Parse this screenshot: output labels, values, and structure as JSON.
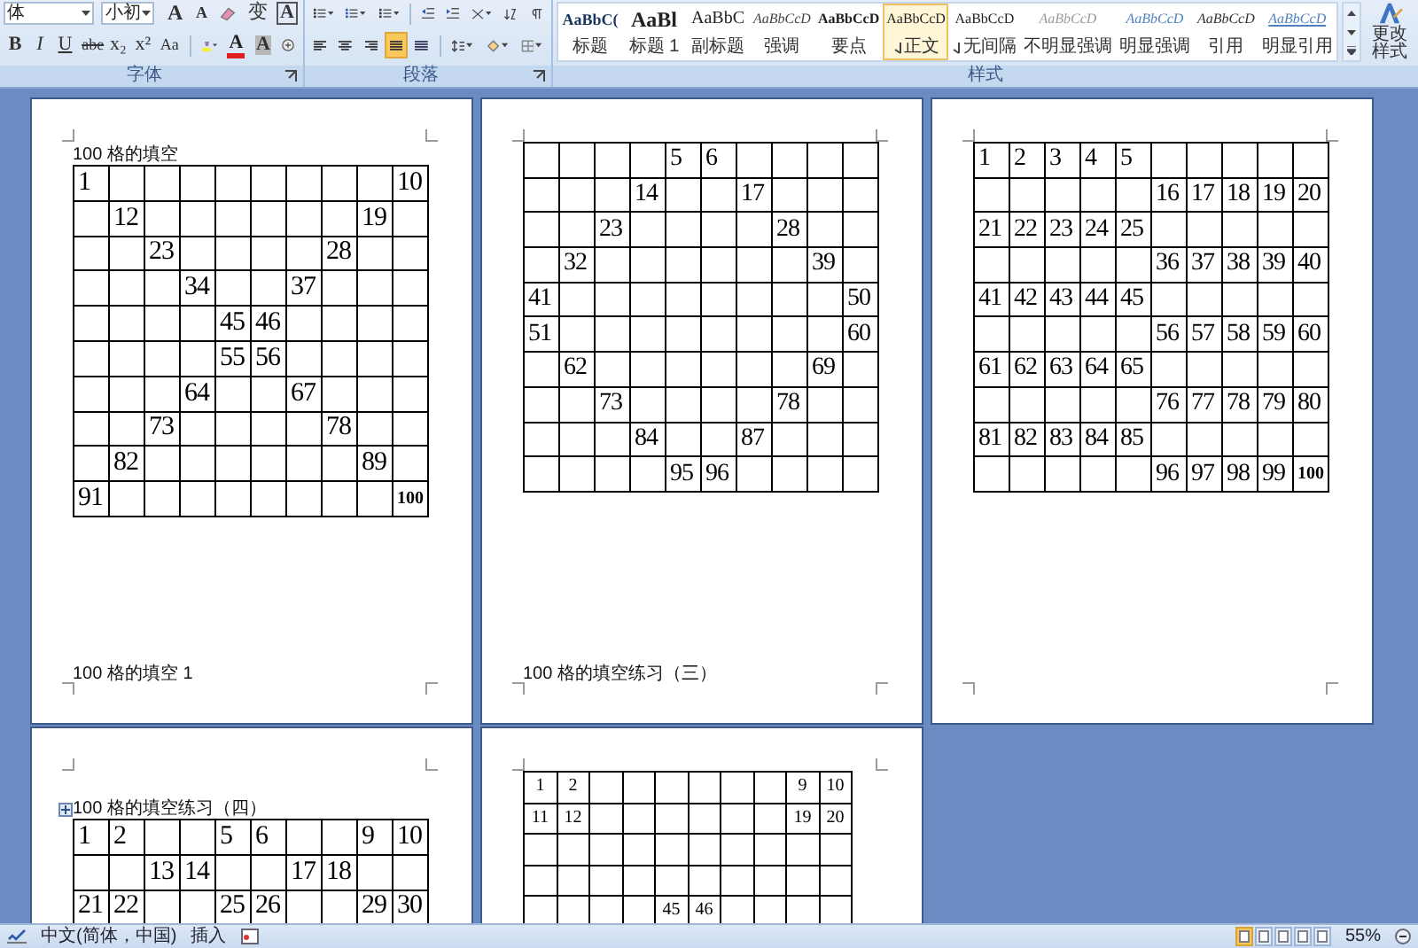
{
  "ribbon": {
    "font_group": {
      "label": "字体",
      "font_name": "体",
      "font_size": "小初",
      "top_buttons": [
        {
          "kind": "grow",
          "label": "A"
        },
        {
          "kind": "shrink",
          "label": "A"
        },
        {
          "kind": "clear"
        },
        {
          "kind": "phonetic",
          "label": "变"
        },
        {
          "kind": "boxed",
          "label": "A"
        }
      ],
      "bottom_buttons": [
        {
          "kind": "bold",
          "label": "B"
        },
        {
          "kind": "italic",
          "label": "I"
        },
        {
          "kind": "underline",
          "label": "U"
        },
        {
          "kind": "strike",
          "label": "abe"
        },
        {
          "kind": "sub",
          "label": "x₂"
        },
        {
          "kind": "sup",
          "label": "x²"
        },
        {
          "kind": "case",
          "label": "Aa"
        },
        {
          "kind": "highlight"
        },
        {
          "kind": "color",
          "label": "A"
        },
        {
          "kind": "shade",
          "label": "A"
        },
        {
          "kind": "enclose"
        }
      ]
    },
    "paragraph_group": {
      "label": "段落",
      "alignments": [
        {
          "kind": "left",
          "selected": false
        },
        {
          "kind": "center",
          "selected": false
        },
        {
          "kind": "right",
          "selected": false
        },
        {
          "kind": "justify",
          "selected": true
        },
        {
          "kind": "distributed",
          "selected": false
        }
      ]
    },
    "styles_group": {
      "label": "样式",
      "styles": [
        {
          "kind": "title",
          "sample": "AaBbC(",
          "name": "标题",
          "selected": false,
          "paragraph_mark": false
        },
        {
          "kind": "heading",
          "sample": "AaBl",
          "name": "标题 1",
          "selected": false,
          "paragraph_mark": false
        },
        {
          "kind": "subtitle",
          "sample": "AaBbC",
          "name": "副标题",
          "selected": false,
          "paragraph_mark": false
        },
        {
          "kind": "emphasis",
          "sample": "AaBbCcD",
          "name": "强调",
          "selected": false,
          "paragraph_mark": false
        },
        {
          "kind": "strong",
          "sample": "AaBbCcD",
          "name": "要点",
          "selected": false,
          "paragraph_mark": false
        },
        {
          "kind": "normal",
          "sample": "AaBbCcD",
          "name": "正文",
          "selected": true,
          "paragraph_mark": true
        },
        {
          "kind": "normal",
          "sample": "AaBbCcD",
          "name": "无间隔",
          "selected": false,
          "paragraph_mark": true
        },
        {
          "kind": "subtle",
          "sample": "AaBbCcD",
          "name": "不明显强调",
          "selected": false,
          "paragraph_mark": false
        },
        {
          "kind": "intense",
          "sample": "AaBbCcD",
          "name": "明显强调",
          "selected": false,
          "paragraph_mark": false
        },
        {
          "kind": "quote",
          "sample": "AaBbCcD",
          "name": "引用",
          "selected": false,
          "paragraph_mark": false
        },
        {
          "kind": "intense_quote",
          "sample": "AaBbCcD",
          "name": "明显引用",
          "selected": false,
          "paragraph_mark": false
        }
      ],
      "change_styles": "更改样式"
    }
  },
  "pages": [
    {
      "kind": "large",
      "header": "100 格的填空",
      "anchor": false,
      "footer": "100 格的填空 1",
      "rows": [
        [
          "1",
          null,
          null,
          null,
          null,
          null,
          null,
          null,
          null,
          "10"
        ],
        [
          null,
          "12",
          null,
          null,
          null,
          null,
          null,
          null,
          "19",
          null
        ],
        [
          null,
          null,
          "23",
          null,
          null,
          null,
          null,
          "28",
          null,
          null
        ],
        [
          null,
          null,
          null,
          "34",
          null,
          null,
          "37",
          null,
          null,
          null
        ],
        [
          null,
          null,
          null,
          null,
          "45",
          "46",
          null,
          null,
          null,
          null
        ],
        [
          null,
          null,
          null,
          null,
          "55",
          "56",
          null,
          null,
          null,
          null
        ],
        [
          null,
          null,
          null,
          "64",
          null,
          null,
          "67",
          null,
          null,
          null
        ],
        [
          null,
          null,
          "73",
          null,
          null,
          null,
          null,
          "78",
          null,
          null
        ],
        [
          null,
          "82",
          null,
          null,
          null,
          null,
          null,
          null,
          "89",
          null
        ],
        [
          "91",
          null,
          null,
          null,
          null,
          null,
          null,
          null,
          null,
          "100"
        ]
      ]
    },
    {
      "kind": "medium",
      "footer": "100 格的填空练习（三）",
      "rows": [
        [
          null,
          null,
          null,
          null,
          "5",
          "6",
          null,
          null,
          null,
          null
        ],
        [
          null,
          null,
          null,
          "14",
          null,
          null,
          "17",
          null,
          null,
          null
        ],
        [
          null,
          null,
          "23",
          null,
          null,
          null,
          null,
          "28",
          null,
          null
        ],
        [
          null,
          "32",
          null,
          null,
          null,
          null,
          null,
          null,
          "39",
          null
        ],
        [
          "41",
          null,
          null,
          null,
          null,
          null,
          null,
          null,
          null,
          "50"
        ],
        [
          "51",
          null,
          null,
          null,
          null,
          null,
          null,
          null,
          null,
          "60"
        ],
        [
          null,
          "62",
          null,
          null,
          null,
          null,
          null,
          null,
          "69",
          null
        ],
        [
          null,
          null,
          "73",
          null,
          null,
          null,
          null,
          "78",
          null,
          null
        ],
        [
          null,
          null,
          null,
          "84",
          null,
          null,
          "87",
          null,
          null,
          null
        ],
        [
          null,
          null,
          null,
          null,
          "95",
          "96",
          null,
          null,
          null,
          null
        ]
      ]
    },
    {
      "kind": "medium",
      "rows": [
        [
          "1",
          "2",
          "3",
          "4",
          "5",
          null,
          null,
          null,
          null,
          null
        ],
        [
          null,
          null,
          null,
          null,
          null,
          "16",
          "17",
          "18",
          "19",
          "20"
        ],
        [
          "21",
          "22",
          "23",
          "24",
          "25",
          null,
          null,
          null,
          null,
          null
        ],
        [
          null,
          null,
          null,
          null,
          null,
          "36",
          "37",
          "38",
          "39",
          "40"
        ],
        [
          "41",
          "42",
          "43",
          "44",
          "45",
          null,
          null,
          null,
          null,
          null
        ],
        [
          null,
          null,
          null,
          null,
          null,
          "56",
          "57",
          "58",
          "59",
          "60"
        ],
        [
          "61",
          "62",
          "63",
          "64",
          "65",
          null,
          null,
          null,
          null,
          null
        ],
        [
          null,
          null,
          null,
          null,
          null,
          "76",
          "77",
          "78",
          "79",
          "80"
        ],
        [
          "81",
          "82",
          "83",
          "84",
          "85",
          null,
          null,
          null,
          null,
          null
        ],
        [
          null,
          null,
          null,
          null,
          null,
          "96",
          "97",
          "98",
          "99",
          "100"
        ]
      ]
    },
    {
      "kind": "large",
      "header": "100 格的填空练习（四）",
      "anchor": true,
      "rows": [
        [
          "1",
          "2",
          null,
          null,
          "5",
          "6",
          null,
          null,
          "9",
          "10"
        ],
        [
          null,
          null,
          "13",
          "14",
          null,
          null,
          "17",
          "18",
          null,
          null
        ],
        [
          "21",
          "22",
          null,
          null,
          "25",
          "26",
          null,
          null,
          "29",
          "30"
        ]
      ]
    },
    {
      "kind": "small",
      "rows": [
        [
          "1",
          "2",
          null,
          null,
          null,
          null,
          null,
          null,
          "9",
          "10"
        ],
        [
          "11",
          "12",
          null,
          null,
          null,
          null,
          null,
          null,
          "19",
          "20"
        ],
        [
          null,
          null,
          null,
          null,
          null,
          null,
          null,
          null,
          null,
          null
        ],
        [
          null,
          null,
          null,
          null,
          null,
          null,
          null,
          null,
          null,
          null
        ],
        [
          null,
          null,
          null,
          null,
          "45",
          "46",
          null,
          null,
          null,
          null
        ]
      ]
    }
  ],
  "status_bar": {
    "language": "中文(简体，中国)",
    "mode": "插入",
    "views": [
      {
        "selected": true
      },
      {
        "selected": false
      },
      {
        "selected": false
      },
      {
        "selected": false
      },
      {
        "selected": false
      }
    ],
    "zoom": "55%"
  }
}
